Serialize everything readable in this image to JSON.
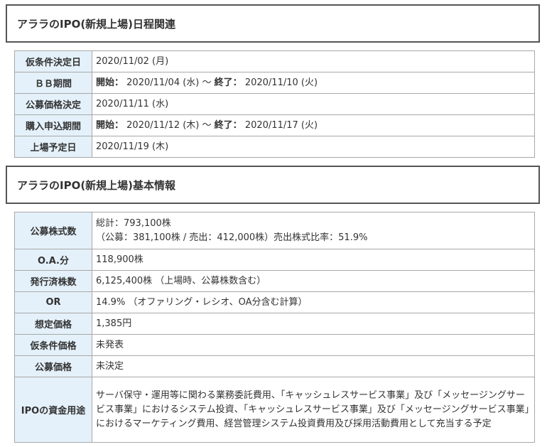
{
  "schedule": {
    "title": "アララのIPO(新規上場)日程関連",
    "rows": {
      "conditions_decision": {
        "label": "仮条件決定日",
        "value": "2020/11/02 (月)"
      },
      "bb_period": {
        "label": "ＢＢ期間",
        "start_label": "開始：",
        "start": "2020/11/04 (水)",
        "sep": "～",
        "end_label": "終了：",
        "end": "2020/11/10 (火)"
      },
      "offer_price_decision": {
        "label": "公募価格決定",
        "value": "2020/11/11 (水)"
      },
      "application_period": {
        "label": "購入申込期間",
        "start_label": "開始：",
        "start": "2020/11/12 (木)",
        "sep": "～",
        "end_label": "終了：",
        "end": "2020/11/17 (火)"
      },
      "listing_date": {
        "label": "上場予定日",
        "value": "2020/11/19 (木)"
      }
    }
  },
  "basic": {
    "title": "アララのIPO(新規上場)基本情報",
    "rows": {
      "offering_shares": {
        "label": "公募株式数",
        "line1": "総計：793,100株",
        "line2": "（公募：381,100株 / 売出：412,000株）売出株式比率：51.9%"
      },
      "oa": {
        "label": "O.A.分",
        "value": "118,900株"
      },
      "issued_shares": {
        "label": "発行済株数",
        "value": "6,125,400株 （上場時、公募株数含む）"
      },
      "or": {
        "label": "OR",
        "value": "14.9% （オファリング・レシオ、OA分含む計算）"
      },
      "assumed_price": {
        "label": "想定価格",
        "value": "1,385円"
      },
      "tentative_price": {
        "label": "仮条件価格",
        "value": "未発表"
      },
      "offer_price": {
        "label": "公募価格",
        "value": "未決定"
      },
      "use_of_funds": {
        "label": "IPOの資金用途",
        "value": "サーバ保守・運用等に関わる業務委託費用、「キャッシュレスサービス事業」及び「メッセージングサービス事業」におけるシステム投資、「キャッシュレスサービス事業」及び「メッセージングサービス事業」におけるマーケティング費用、経営管理システム投資費用及び採用活動費用として充当する予定"
      }
    }
  },
  "colors": {
    "header_cell_bg": "#e4f1fa",
    "border": "#a8a8a8",
    "title_border": "#555555",
    "listing_date_text": "#d01010"
  }
}
